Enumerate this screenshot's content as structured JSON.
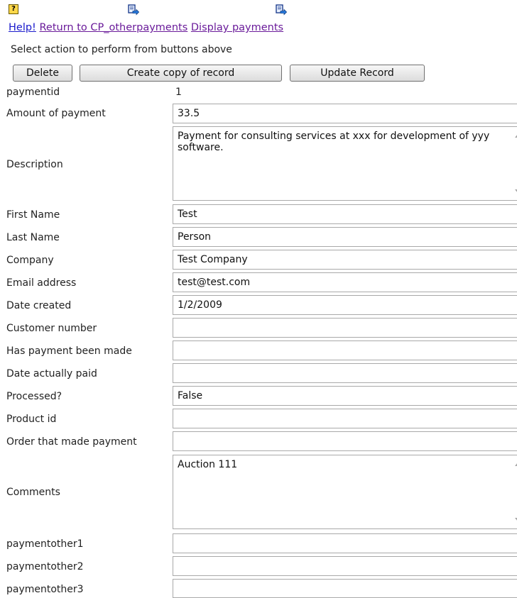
{
  "links": {
    "help": "Help!",
    "return": "Return to CP_otherpayments",
    "display": "Display payments"
  },
  "icons": [
    "help-icon",
    "navigate-icon",
    "navigate-icon"
  ],
  "instruction": "Select action to perform from buttons above",
  "buttons": {
    "delete": "Delete",
    "copy": "Create copy of record",
    "update": "Update Record"
  },
  "fields": {
    "paymentid": {
      "label": "paymentid",
      "value": "1"
    },
    "amount": {
      "label": "Amount of payment",
      "value": "33.5"
    },
    "description": {
      "label": "Description",
      "value": "Payment for consulting services at xxx for development of yyy software."
    },
    "first_name": {
      "label": "First Name",
      "value": "Test"
    },
    "last_name": {
      "label": "Last Name",
      "value": "Person"
    },
    "company": {
      "label": "Company",
      "value": "Test Company"
    },
    "email": {
      "label": "Email address",
      "value": "test@test.com"
    },
    "date_created": {
      "label": "Date created",
      "value": "1/2/2009"
    },
    "customer_number": {
      "label": "Customer number",
      "value": ""
    },
    "payment_made": {
      "label": "Has payment been made",
      "value": ""
    },
    "date_paid": {
      "label": "Date actually paid",
      "value": ""
    },
    "processed": {
      "label": "Processed?",
      "value": "False"
    },
    "product_id": {
      "label": "Product id",
      "value": ""
    },
    "order": {
      "label": "Order that made payment",
      "value": ""
    },
    "comments": {
      "label": "Comments",
      "value": "Auction 111"
    },
    "po1": {
      "label": "paymentother1",
      "value": ""
    },
    "po2": {
      "label": "paymentother2",
      "value": ""
    },
    "po3": {
      "label": "paymentother3",
      "value": ""
    }
  }
}
